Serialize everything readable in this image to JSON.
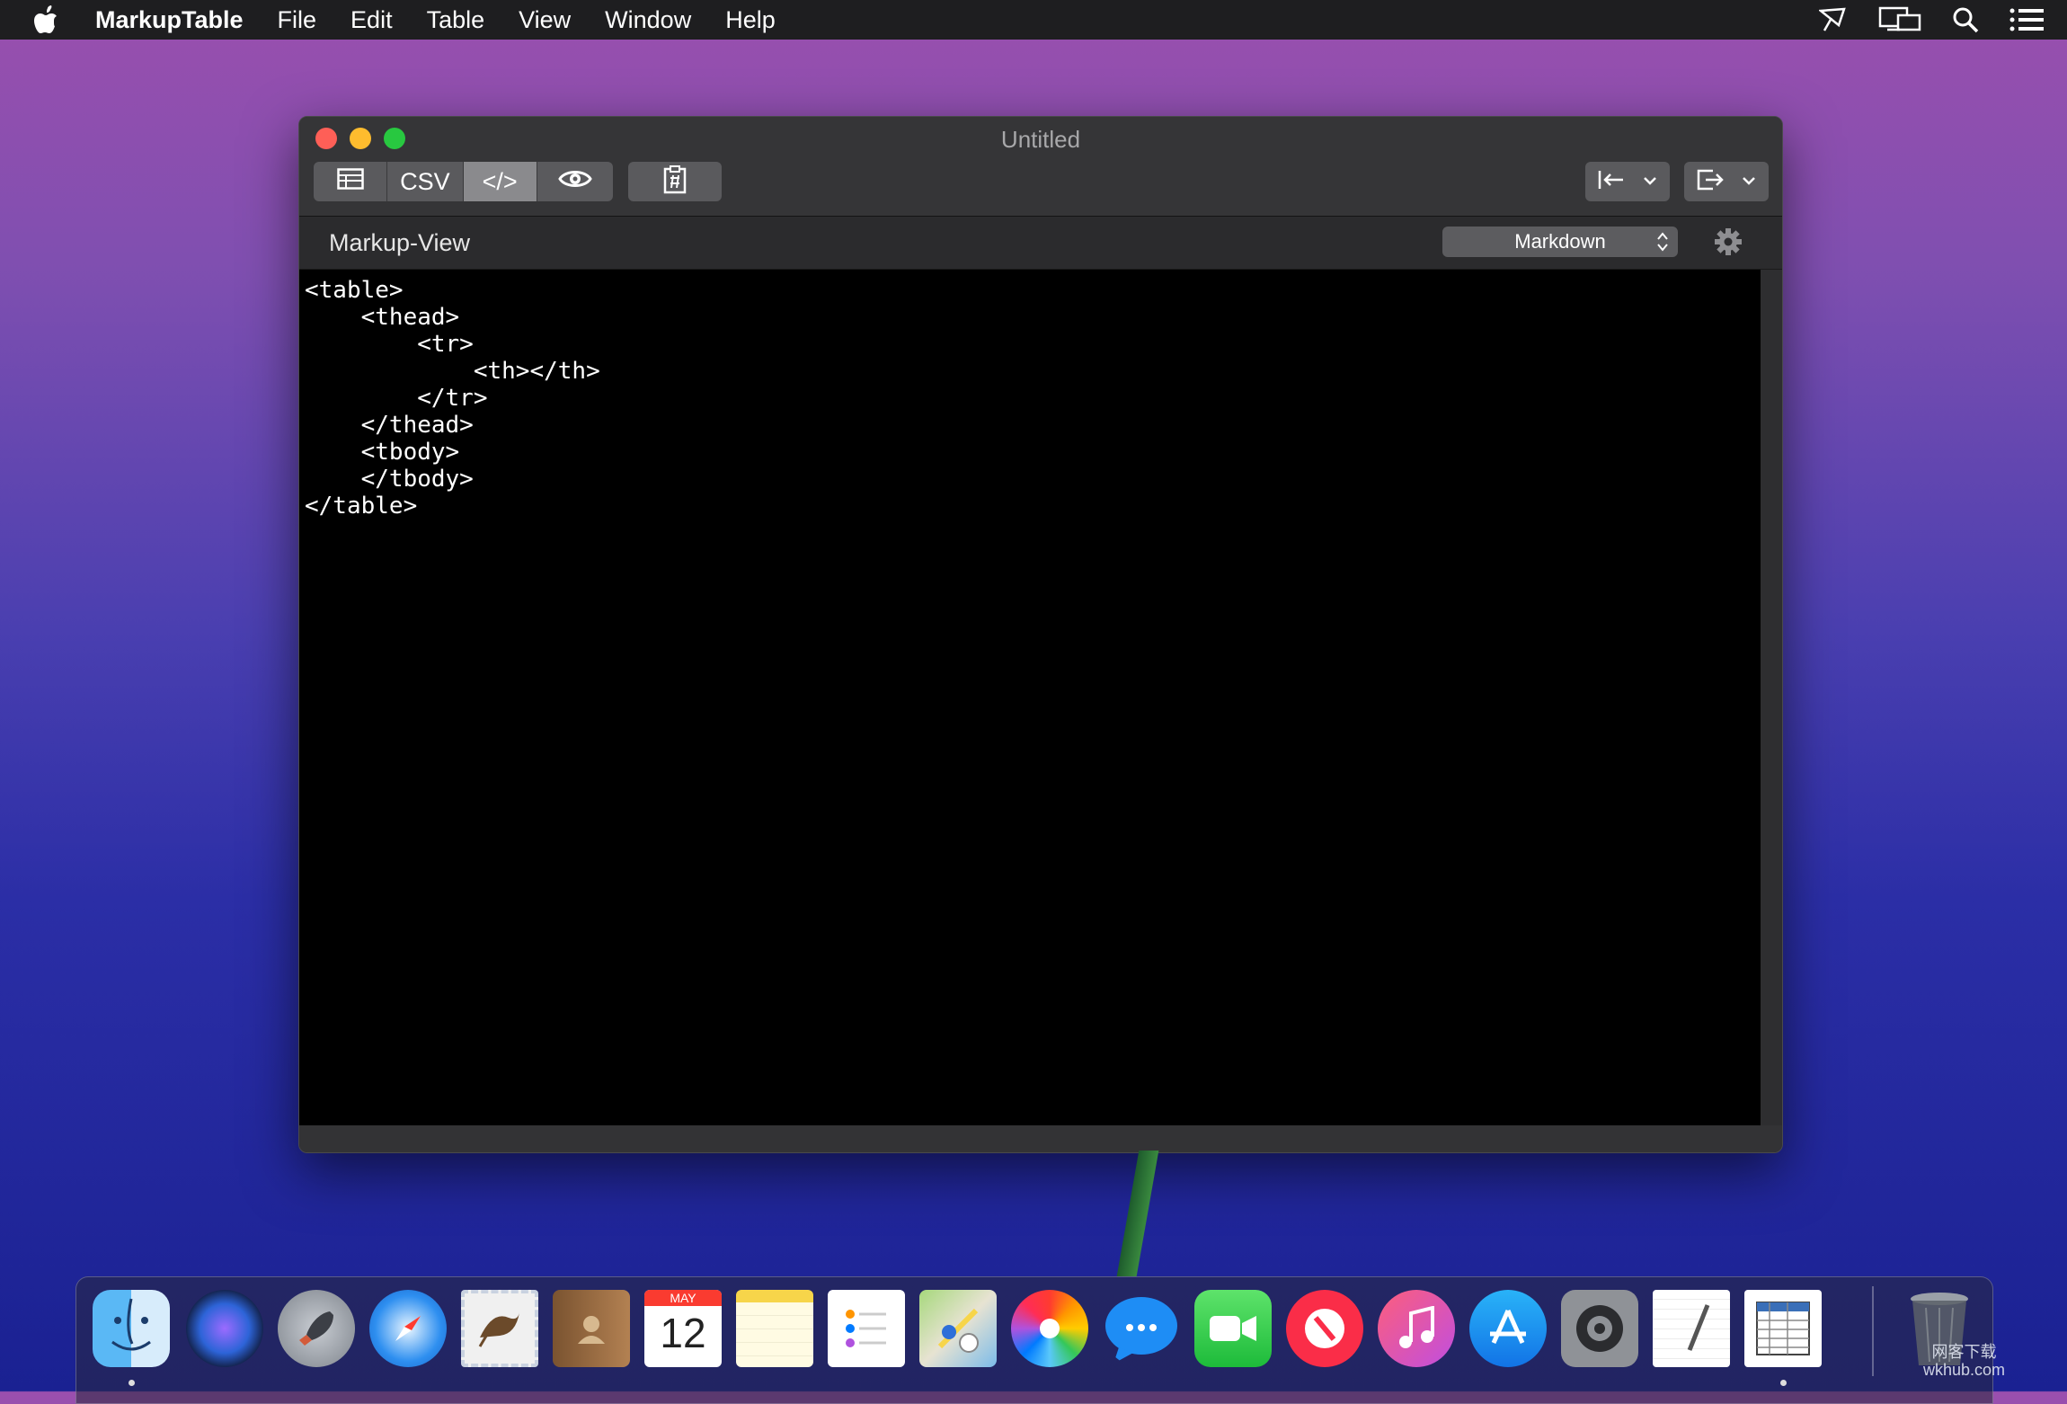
{
  "menubar": {
    "app_name": "MarkupTable",
    "items": [
      "File",
      "Edit",
      "Table",
      "View",
      "Window",
      "Help"
    ],
    "status_icons": [
      "airplay-icon",
      "display-icon",
      "spotlight-icon",
      "control-center-icon"
    ]
  },
  "window": {
    "title": "Untitled",
    "toolbar": {
      "view_modes": [
        {
          "name": "table-view-button",
          "icon": "table-icon",
          "label": ""
        },
        {
          "name": "csv-view-button",
          "icon": "",
          "label": "CSV"
        },
        {
          "name": "markup-view-button",
          "icon": "",
          "label": "</>",
          "active": true
        },
        {
          "name": "preview-button",
          "icon": "eye-icon",
          "label": ""
        }
      ],
      "clipboard_icon": "paste-table-icon",
      "import_icon": "import-icon",
      "export_icon": "export-icon"
    },
    "subbar": {
      "title": "Markup-View",
      "format_value": "Markdown"
    },
    "editor": {
      "code": "<table>\n    <thead>\n        <tr>\n            <th></th>\n        </tr>\n    </thead>\n    <tbody>\n    </tbody>\n</table>"
    }
  },
  "dock": {
    "apps": [
      "Finder",
      "Siri",
      "Launchpad",
      "Safari",
      "Mail",
      "Contacts",
      "Calendar",
      "Notes",
      "Reminders",
      "Maps",
      "Photos",
      "Messages",
      "FaceTime",
      "News",
      "iTunes",
      "App Store",
      "System Preferences",
      "TextEdit",
      "MarkupTable",
      "Trash"
    ],
    "calendar_month": "MAY",
    "calendar_day": "12"
  },
  "watermark": {
    "line1": "网客下载",
    "line2": "wkhub.com"
  },
  "colors": {
    "close": "#fe5f57",
    "minimize": "#febc2e",
    "maximize": "#28c840",
    "editor_bg": "#000000"
  }
}
